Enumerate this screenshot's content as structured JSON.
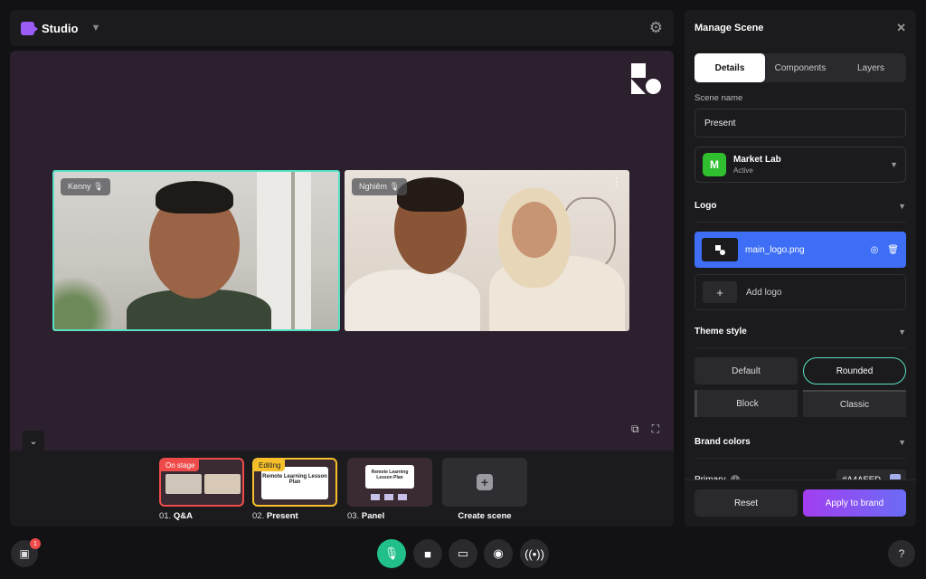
{
  "app": {
    "title": "Studio"
  },
  "stage": {
    "participants": [
      {
        "name": "Kenny",
        "mic": "on"
      },
      {
        "name": "Nghiêm",
        "mic": "on"
      }
    ]
  },
  "scenes": [
    {
      "index": "01.",
      "name": "Q&A",
      "badge": "On stage",
      "badge_color": "#ef4b4b"
    },
    {
      "index": "02.",
      "name": "Present",
      "badge": "Editing",
      "badge_color": "#f7c02b",
      "slide_text": "Remote Learning Lesson Plan"
    },
    {
      "index": "03.",
      "name": "Panel",
      "slide_text": "Remote Learning Lesson Plan"
    },
    {
      "name": "Create scene"
    }
  ],
  "controls": {
    "notification_count": "1"
  },
  "panel": {
    "title": "Manage Scene",
    "tabs": [
      "Details",
      "Components",
      "Layers"
    ],
    "active_tab": "Details",
    "scene_name_label": "Scene name",
    "scene_name_value": "Present",
    "brand": {
      "initial": "M",
      "name": "Market Lab",
      "status": "Active",
      "color": "#2fbf2f"
    },
    "logo_section": "Logo",
    "logo_file": "main_logo.png",
    "add_logo": "Add logo",
    "theme_section": "Theme style",
    "themes": [
      "Default",
      "Rounded",
      "Block",
      "Classic"
    ],
    "selected_theme": "Rounded",
    "brand_colors_section": "Brand colors",
    "primary_label": "Primary",
    "primary_hex": "#A4AEED",
    "reset_label": "Reset",
    "apply_label": "Apply to brand"
  },
  "colors": {
    "accent_teal": "#59e0c4",
    "mic_green": "#21c08b",
    "logo_row_blue": "#3d6ef5"
  }
}
